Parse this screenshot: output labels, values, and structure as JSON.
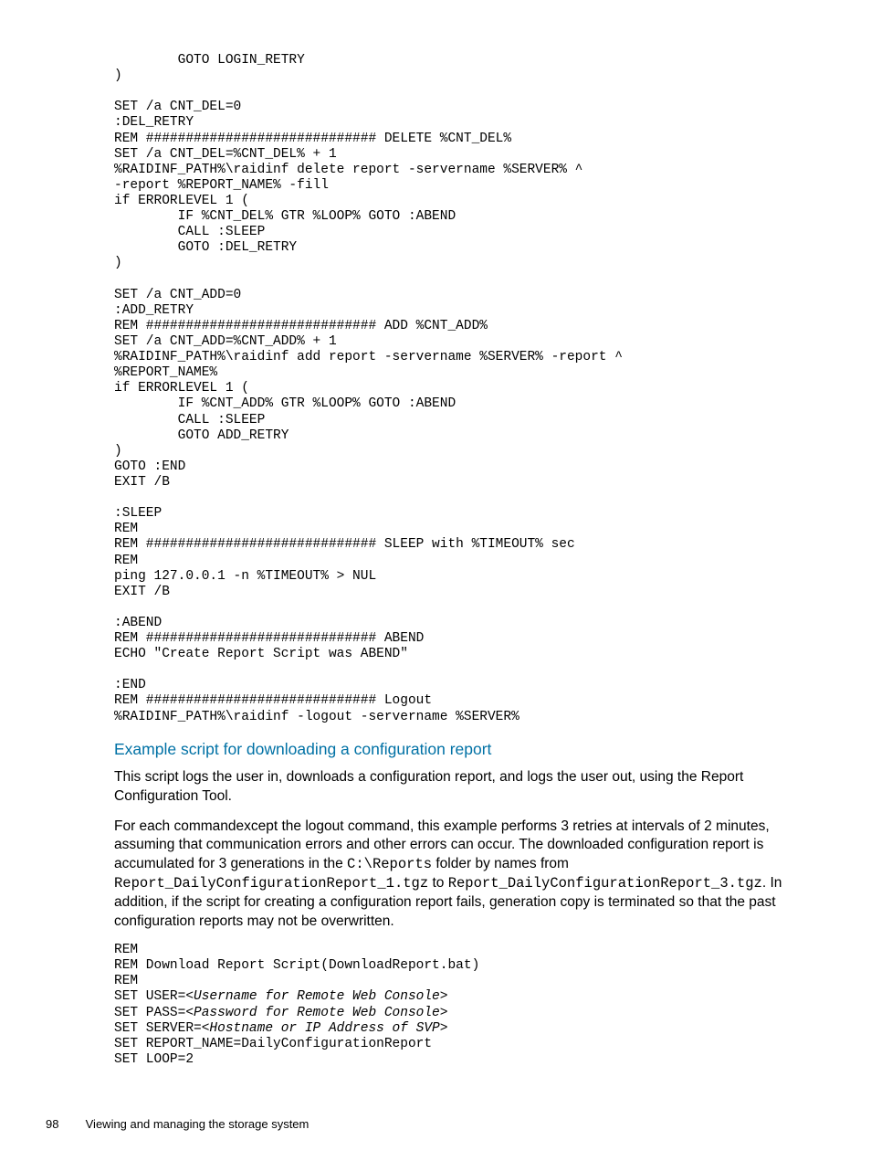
{
  "code1": "        GOTO LOGIN_RETRY\n)\n\nSET /a CNT_DEL=0\n:DEL_RETRY\nREM ############################# DELETE %CNT_DEL%\nSET /a CNT_DEL=%CNT_DEL% + 1\n%RAIDINF_PATH%\\raidinf delete report -servername %SERVER% ^\n-report %REPORT_NAME% -fill\nif ERRORLEVEL 1 (\n        IF %CNT_DEL% GTR %LOOP% GOTO :ABEND\n        CALL :SLEEP\n        GOTO :DEL_RETRY\n)\n\nSET /a CNT_ADD=0\n:ADD_RETRY\nREM ############################# ADD %CNT_ADD%\nSET /a CNT_ADD=%CNT_ADD% + 1\n%RAIDINF_PATH%\\raidinf add report -servername %SERVER% -report ^\n%REPORT_NAME%\nif ERRORLEVEL 1 (\n        IF %CNT_ADD% GTR %LOOP% GOTO :ABEND\n        CALL :SLEEP\n        GOTO ADD_RETRY\n)\nGOTO :END\nEXIT /B\n\n:SLEEP\nREM\nREM ############################# SLEEP with %TIMEOUT% sec\nREM\nping 127.0.0.1 -n %TIMEOUT% > NUL\nEXIT /B\n\n:ABEND\nREM ############################# ABEND\nECHO \"Create Report Script was ABEND\"\n\n:END\nREM ############################# Logout\n%RAIDINF_PATH%\\raidinf -logout -servername %SERVER%",
  "heading": "Example script for downloading a configuration report",
  "para1": "This script logs the user in, downloads a configuration report, and logs the user out, using the Report Configuration Tool.",
  "para2": {
    "t1": "For each commandexcept the logout command, this example performs 3 retries at intervals of 2 minutes, assuming that communication errors and other errors can occur. The downloaded configuration report is accumulated for 3 generations in the ",
    "m1": "C:\\Reports",
    "t2": " folder by names from ",
    "m2": "Report_DailyConfigurationReport_1.tgz",
    "t3": " to ",
    "m3": "Report_DailyConfigurationReport_3.tgz",
    "t4": ". In addition, if the script for creating a configuration report fails, generation copy is terminated so that the past configuration reports may not be overwritten."
  },
  "code2": {
    "l1": "REM",
    "l2": "REM Download Report Script(DownloadReport.bat)",
    "l3": "REM",
    "l4a": "SET USER=<",
    "l4b": "Username for Remote Web Console",
    "l4c": ">",
    "l5a": "SET PASS=<",
    "l5b": "Password for Remote Web Console",
    "l5c": ">",
    "l6a": "SET SERVER=<",
    "l6b": "Hostname or IP Address of SVP",
    "l6c": ">",
    "l7": "SET REPORT_NAME=DailyConfigurationReport",
    "l8": "SET LOOP=2"
  },
  "footer": {
    "page": "98",
    "title": "Viewing and managing the storage system"
  }
}
